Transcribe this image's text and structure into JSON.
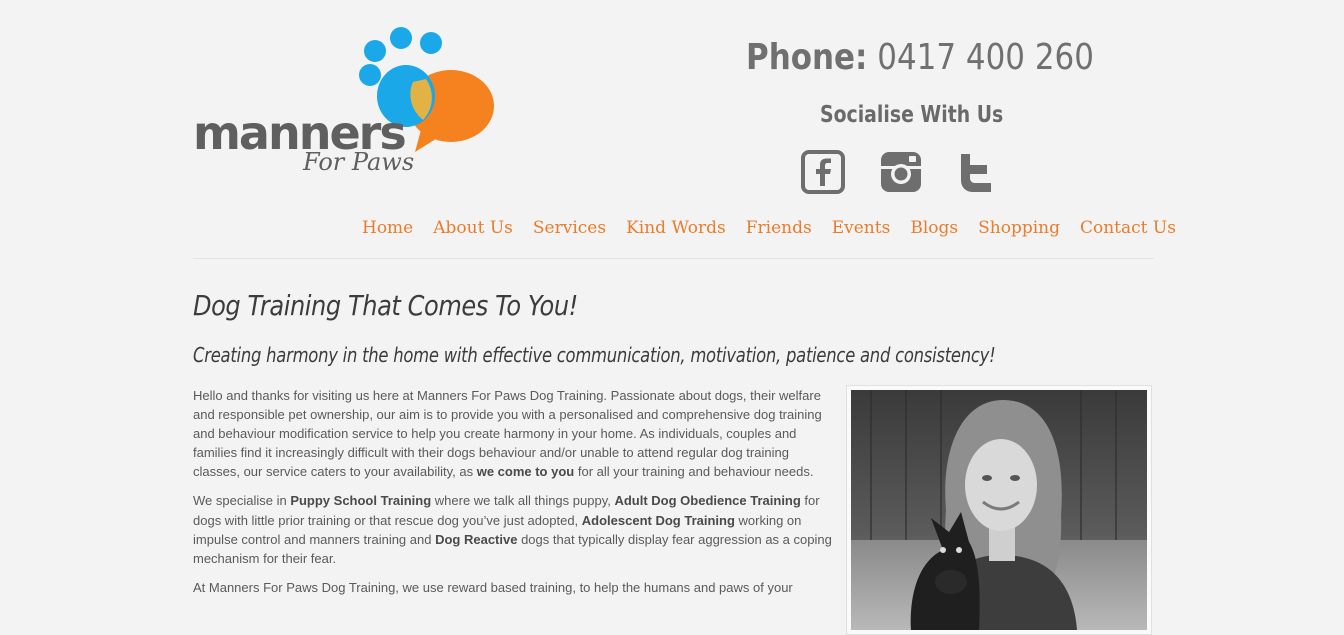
{
  "logo": {
    "word": "manners",
    "sub": "For Paws"
  },
  "header": {
    "phone_label": "Phone:",
    "phone_number": "0417 400 260",
    "socialise": "Socialise With Us",
    "social": [
      {
        "name": "facebook-icon"
      },
      {
        "name": "instagram-icon"
      },
      {
        "name": "twitter-icon"
      }
    ]
  },
  "nav": {
    "items": [
      "Home",
      "About Us",
      "Services",
      "Kind Words",
      "Friends",
      "Events",
      "Blogs",
      "Shopping",
      "Contact Us"
    ]
  },
  "main": {
    "title": "Dog Training That Comes To You!",
    "subtitle": "Creating harmony in the home with effective communication, motivation, patience and consistency!",
    "p1": {
      "a": "Hello and thanks for visiting us here at Manners For Paws Dog Training.  Passionate about dogs, their welfare and responsible pet ownership, our aim is to provide you with a personalised and comprehensive dog training and behaviour modification service to help you create harmony in your home. As individuals, couples and families find it increasingly difficult with their dogs behaviour and/or unable to attend regular dog training classes, our service caters to your availability, as ",
      "b": "we come to you",
      "c": " for all your training and behaviour needs."
    },
    "p2": {
      "t1": "We specialise in ",
      "b1": "Puppy School Training",
      "t2": " where we talk all things puppy, ",
      "b2": "Adult Dog Obedience Training",
      "t3": " for dogs with little prior training or that rescue dog you’ve just adopted, ",
      "b3": "Adolescent Dog Training",
      "t4": " working on impulse control and manners training and ",
      "b4": "Dog Reactive",
      "t5": " dogs that typically display fear aggression as a coping mechanism for their fear."
    },
    "p3": "At Manners For Paws Dog Training, we use reward based training, to help the humans and paws of your"
  },
  "colors": {
    "accent": "#ec7c2a",
    "paw_blue": "#1aa8e8",
    "bubble_orange": "#f5811f",
    "text": "#5a5a5a"
  }
}
